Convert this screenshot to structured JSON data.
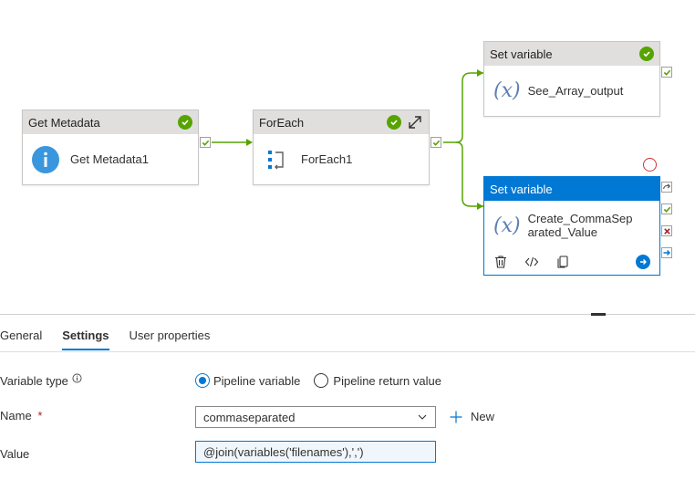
{
  "pipeline": {
    "get_metadata": {
      "type": "Get Metadata",
      "name": "Get Metadata1"
    },
    "foreach": {
      "type": "ForEach",
      "name": "ForEach1"
    },
    "set_var_1": {
      "type": "Set variable",
      "name": "See_Array_output"
    },
    "set_var_2": {
      "type": "Set variable",
      "name_line1": "Create_CommaSep",
      "name_line2": "arated_Value"
    },
    "icons": {
      "success": "check-circle-icon",
      "expand": "expand-arrows-icon",
      "info": "info-icon",
      "variable": "variable-x-icon"
    },
    "colors": {
      "success": "#57a300",
      "accent": "#0078d4",
      "fail": "#a4262c"
    }
  },
  "tabs": [
    {
      "label": "General"
    },
    {
      "label": "Settings",
      "active": true
    },
    {
      "label": "User properties"
    }
  ],
  "settings": {
    "variable_type_label": "Variable type",
    "radio_pipeline": "Pipeline variable",
    "radio_return": "Pipeline return value",
    "selected_type": "Pipeline variable",
    "name_label": "Name",
    "required_mark": "*",
    "name_value": "commaseparated",
    "new_label": "New",
    "value_label": "Value",
    "value_value": "@join(variables('filenames'),',')"
  }
}
